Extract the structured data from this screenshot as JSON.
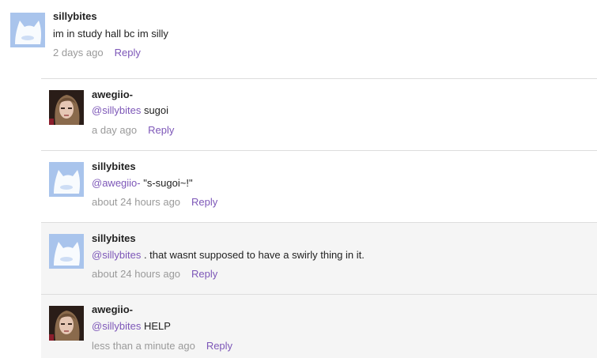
{
  "comments": [
    {
      "author": "sillybites",
      "avatar": "cat-avatar",
      "mention": "",
      "text": "im in study hall bc im silly",
      "time": "2 days ago",
      "reply": "Reply"
    },
    {
      "author": "awegiio-",
      "avatar": "girl-avatar",
      "mention": "@sillybites",
      "text": " sugoi",
      "time": "a day ago",
      "reply": "Reply"
    },
    {
      "author": "sillybites",
      "avatar": "cat-avatar",
      "mention": "@awegiio-",
      "text": " \"s-sugoi~!\"",
      "time": "about 24 hours ago",
      "reply": "Reply"
    },
    {
      "author": "sillybites",
      "avatar": "cat-avatar",
      "mention": "@sillybites",
      "text": " . that wasnt supposed to have a swirly thing in it.",
      "time": "about 24 hours ago",
      "reply": "Reply"
    },
    {
      "author": "awegiio-",
      "avatar": "girl-avatar",
      "mention": "@sillybites",
      "text": " HELP",
      "time": "less than a minute ago",
      "reply": "Reply"
    }
  ],
  "colors": {
    "link": "#7d57b8",
    "meta": "#9a9a9a",
    "divider": "#dddddd",
    "highlight": "#f5f5f5"
  }
}
